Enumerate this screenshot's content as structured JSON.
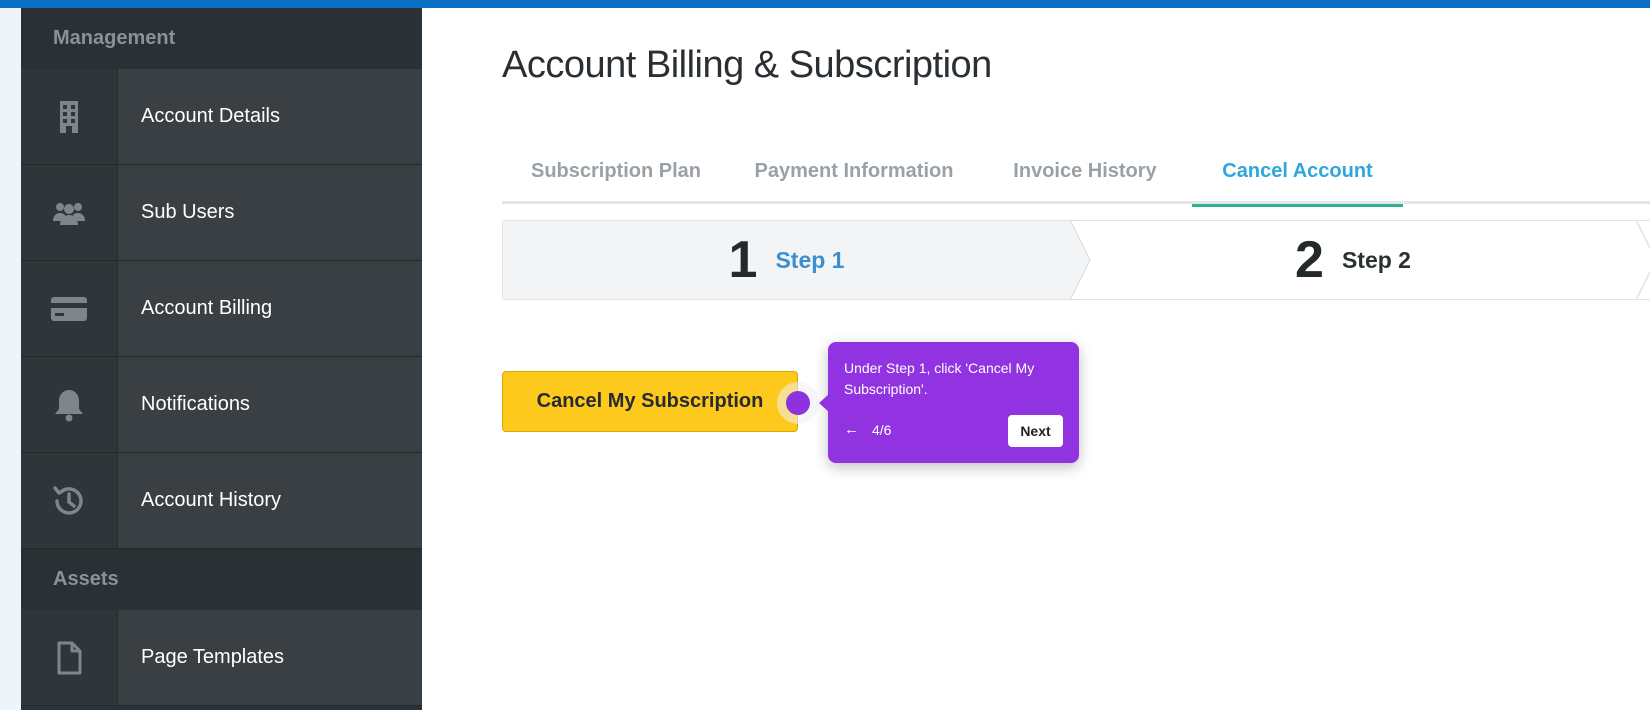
{
  "colors": {
    "topbar": "#0a6fc2",
    "sidebar_bg": "#2b3134",
    "accent_tab": "#2ea7d9",
    "tab_underline": "#2fb28f",
    "primary_button": "#fdc91c",
    "tooltip": "#9133e0"
  },
  "sidebar": {
    "sections": [
      {
        "heading": "Management",
        "items": [
          {
            "label": "Account Details",
            "icon": "building-icon"
          },
          {
            "label": "Sub Users",
            "icon": "users-icon"
          },
          {
            "label": "Account Billing",
            "icon": "credit-card-icon"
          },
          {
            "label": "Notifications",
            "icon": "bell-icon"
          },
          {
            "label": "Account History",
            "icon": "history-icon"
          }
        ]
      },
      {
        "heading": "Assets",
        "items": [
          {
            "label": "Page Templates",
            "icon": "file-icon"
          }
        ]
      }
    ]
  },
  "main": {
    "title": "Account Billing & Subscription",
    "tabs": [
      {
        "label": "Subscription Plan",
        "active": false
      },
      {
        "label": "Payment Information",
        "active": false
      },
      {
        "label": "Invoice History",
        "active": false
      },
      {
        "label": "Cancel Account",
        "active": true
      }
    ],
    "steps": [
      {
        "number": "1",
        "label": "Step 1",
        "active": true
      },
      {
        "number": "2",
        "label": "Step 2",
        "active": false
      }
    ],
    "cancel_button_label": "Cancel My Subscription"
  },
  "tooltip": {
    "text": "Under Step 1, click 'Cancel My Subscription'.",
    "back_icon": "arrow-left-icon",
    "back_glyph": "←",
    "progress": "4/6",
    "next_label": "Next"
  }
}
